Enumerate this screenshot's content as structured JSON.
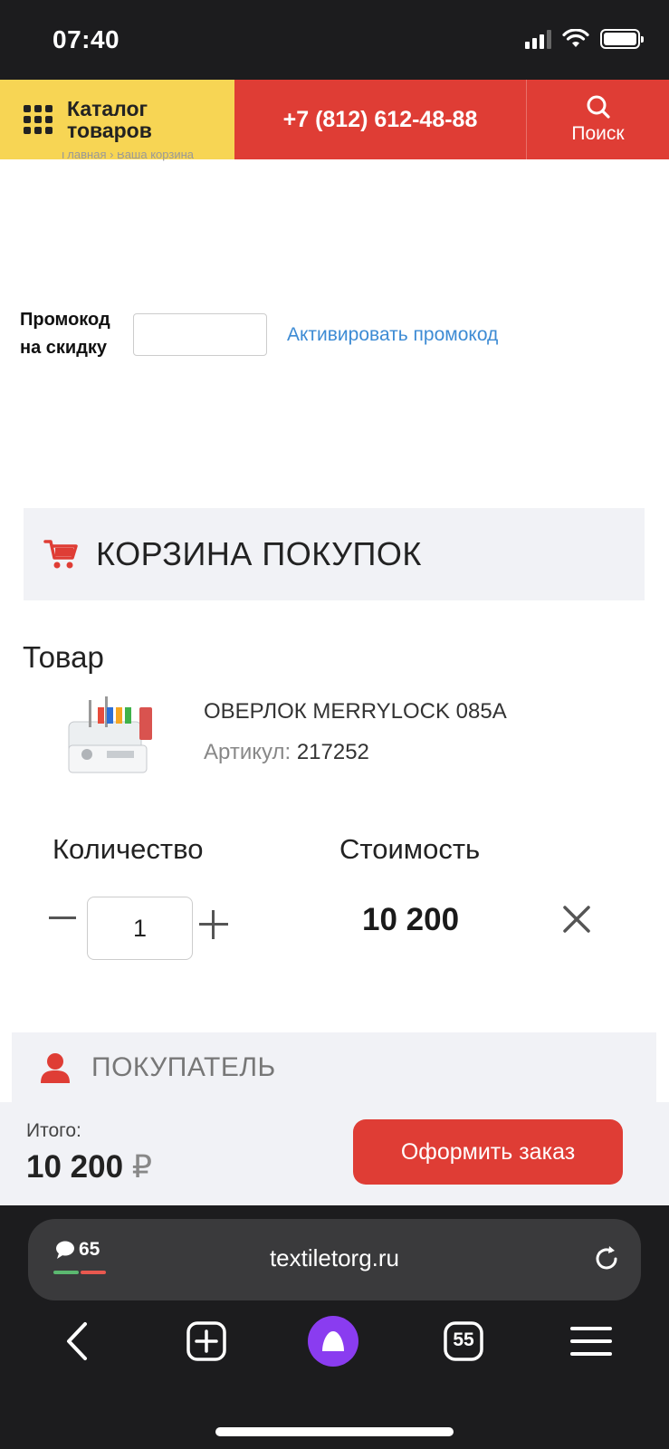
{
  "status_bar": {
    "time": "07:40"
  },
  "header": {
    "catalog_label": "Каталог товаров",
    "phone": "+7 (812) 612-48-88",
    "search_label": "Поиск"
  },
  "breadcrumb": "Главная › Ваша корзина",
  "promo": {
    "label": "Промокод на скидку",
    "input_value": "",
    "activate_link": "Активировать промокод"
  },
  "cart": {
    "title": "КОРЗИНА ПОКУПОК",
    "product_column": "Товар",
    "items": [
      {
        "name": "ОВЕРЛОК MERRYLOCK 085A",
        "sku_label": "Артикул:",
        "sku": "217252",
        "quantity": "1",
        "cost": "10 200"
      }
    ],
    "quantity_column": "Количество",
    "cost_column": "Стоимость"
  },
  "buyer": {
    "title": "ПОКУПАТЕЛЬ"
  },
  "total": {
    "label": "Итого:",
    "value": "10 200",
    "currency": "₽",
    "checkout_label": "Оформить заказ"
  },
  "browser": {
    "comment_count": "65",
    "url": "textiletorg.ru",
    "tab_count": "55"
  },
  "colors": {
    "accent_red": "#df3d35",
    "catalog_yellow": "#f7d554",
    "link_blue": "#3d8bd4",
    "alice_purple": "#8a3cf0"
  }
}
